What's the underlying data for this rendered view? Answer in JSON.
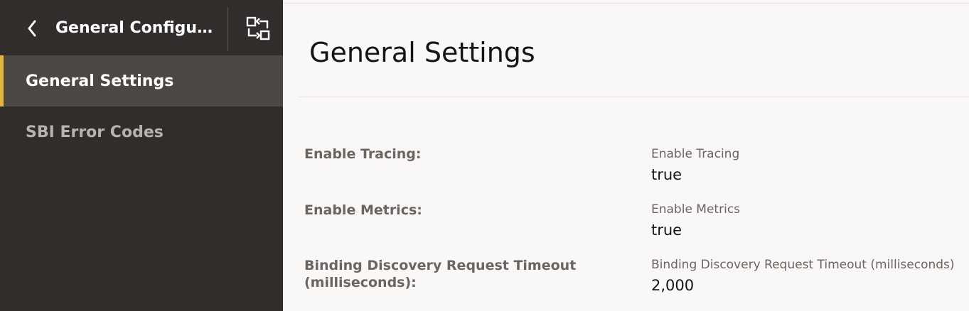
{
  "sidebar": {
    "header_title": "General Configur...",
    "back_icon": "chevron-left-icon",
    "switch_icon": "switch-view-icon",
    "items": [
      {
        "label": "General Settings",
        "active": true
      },
      {
        "label": "SBI Error Codes",
        "active": false
      }
    ]
  },
  "main": {
    "title": "General Settings",
    "fields": [
      {
        "label": "Enable Tracing:",
        "readonly_label": "Enable Tracing",
        "value": "true"
      },
      {
        "label": "Enable Metrics:",
        "readonly_label": "Enable Metrics",
        "value": "true"
      },
      {
        "label": "Binding Discovery Request Timeout (milliseconds):",
        "readonly_label": "Binding Discovery Request Timeout (milliseconds)",
        "value": "2,000"
      }
    ]
  },
  "colors": {
    "sidebar_bg": "#312d2a",
    "active_item_bg": "#4c4743",
    "accent": "#e0b548",
    "content_bg": "#f9f8f6"
  }
}
